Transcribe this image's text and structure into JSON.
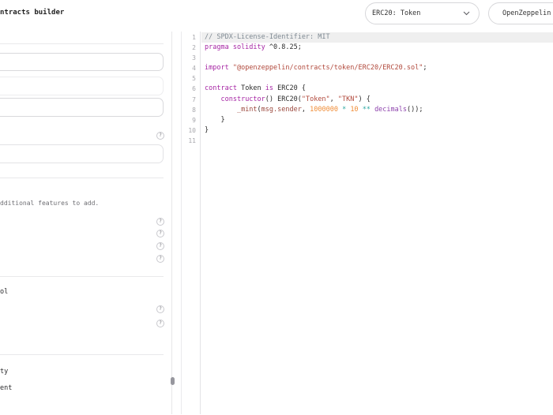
{
  "topbar": {
    "title": "ntracts builder",
    "contract_select_value": "ERC20: Token",
    "brand_button_label": "OpenZeppelin"
  },
  "sidebar": {
    "help_icon": "?",
    "features_hint": "dditional features to add.",
    "access_section_label": "ol",
    "upgrade_section_label": "ty",
    "upgrade_option_label": "ent",
    "input_values": [
      "",
      "",
      "",
      ""
    ]
  },
  "editor": {
    "lines": [
      {
        "num": "1",
        "active": true,
        "tokens": [
          [
            "// SPDX-License-Identifier: MIT",
            "comment"
          ]
        ]
      },
      {
        "num": "2",
        "tokens": [
          [
            "pragma solidity",
            "keyword"
          ],
          [
            " ^0.8.25;",
            "plain"
          ]
        ]
      },
      {
        "num": "3",
        "tokens": []
      },
      {
        "num": "4",
        "tokens": [
          [
            "import",
            "keyword"
          ],
          [
            " ",
            "plain"
          ],
          [
            "\"@openzeppelin/contracts/token/ERC20/ERC20.sol\"",
            "string"
          ],
          [
            ";",
            "plain"
          ]
        ]
      },
      {
        "num": "5",
        "tokens": []
      },
      {
        "num": "6",
        "tokens": [
          [
            "contract",
            "keyword"
          ],
          [
            " Token ",
            "plain"
          ],
          [
            "is",
            "keyword"
          ],
          [
            " ERC20 {",
            "plain"
          ]
        ]
      },
      {
        "num": "7",
        "tokens": [
          [
            "    ",
            "plain"
          ],
          [
            "constructor",
            "keyword"
          ],
          [
            "() ERC20(",
            "plain"
          ],
          [
            "\"Token\"",
            "string"
          ],
          [
            ", ",
            "plain"
          ],
          [
            "\"TKN\"",
            "string"
          ],
          [
            ") {",
            "plain"
          ]
        ]
      },
      {
        "num": "8",
        "tokens": [
          [
            "        ",
            "plain"
          ],
          [
            "_mint",
            "builtin"
          ],
          [
            "(",
            "plain"
          ],
          [
            "msg.sender",
            "builtin"
          ],
          [
            ", ",
            "plain"
          ],
          [
            "1000000",
            "number"
          ],
          [
            " ",
            "plain"
          ],
          [
            "*",
            "operator"
          ],
          [
            " ",
            "plain"
          ],
          [
            "10",
            "number"
          ],
          [
            " ",
            "plain"
          ],
          [
            "**",
            "operator"
          ],
          [
            " ",
            "plain"
          ],
          [
            "decimals",
            "fn"
          ],
          [
            "());",
            "plain"
          ]
        ]
      },
      {
        "num": "9",
        "tokens": [
          [
            "    }",
            "plain"
          ]
        ]
      },
      {
        "num": "10",
        "tokens": [
          [
            "}",
            "plain"
          ]
        ]
      },
      {
        "num": "11",
        "tokens": []
      }
    ]
  },
  "colors": {
    "keyword": "#a626a4",
    "string": "#b1493c",
    "number": "#f08c36",
    "operator": "#2fa8a2",
    "comment": "#7f8a93",
    "active_line_bg": "#efefef",
    "border": "#e6e6e8"
  }
}
